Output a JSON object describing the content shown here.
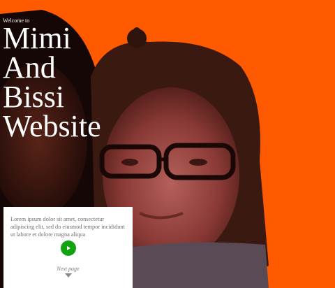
{
  "hero": {
    "welcome": "Welcome to",
    "title_lines": [
      "Mimi",
      "And",
      "Bissi",
      "Website"
    ]
  },
  "card": {
    "text": "Lorem ipsum dolor sit amet, consectetur adipiscing elit, sed do eiusmod tempor incididunt ut labore et dolore magna aliqua",
    "play_icon": "play-icon",
    "next_label": "Next page",
    "next_icon": "chevron-down-icon"
  },
  "colors": {
    "background": "#ff5a00",
    "title": "#ffffff",
    "card": "#ffffff",
    "play_button": "#11a311"
  }
}
